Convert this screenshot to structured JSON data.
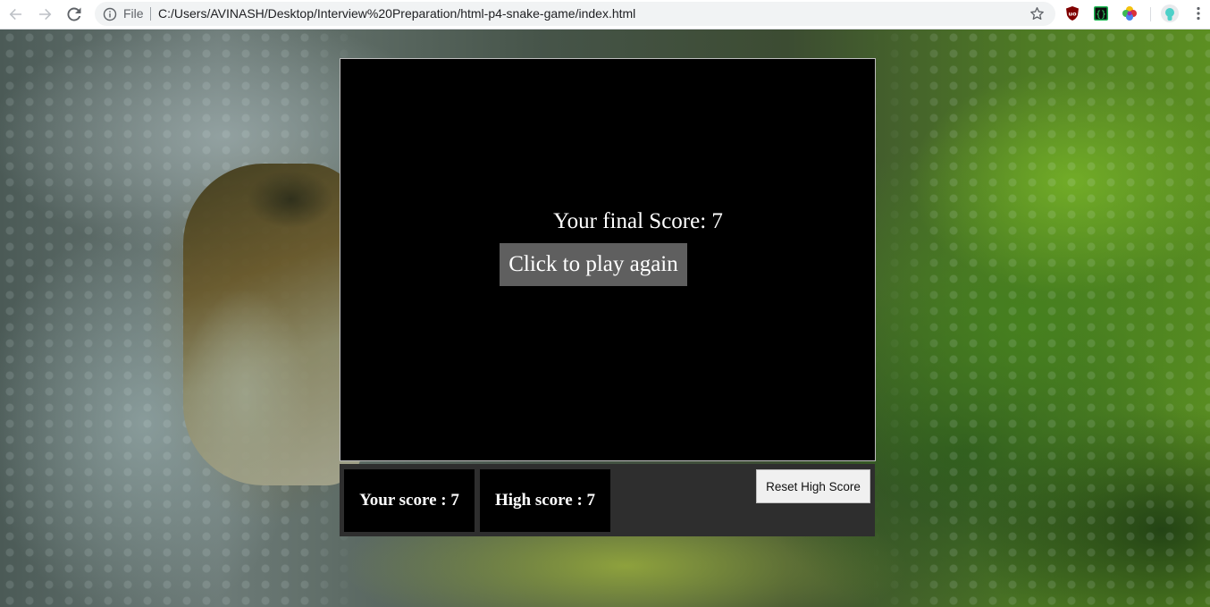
{
  "browser": {
    "scheme_label": "File",
    "url": "C:/Users/AVINASH/Desktop/Interview%20Preparation/html-p4-snake-game/index.html",
    "icons": [
      "back-arrow-icon",
      "forward-arrow-icon",
      "reload-icon",
      "info-icon",
      "bookmark-star-icon",
      "ublock-extension-icon",
      "json-extension-icon",
      "color-picker-extension-icon",
      "profile-avatar-icon",
      "menu-kebab-icon"
    ]
  },
  "game": {
    "final_score_text": "Your final Score: 7",
    "play_again_label": "Click to play again",
    "your_score_label": "Your score : 7",
    "high_score_label": "High score : 7",
    "reset_label": "Reset High Score"
  },
  "colors": {
    "board": "#000000",
    "button_gray": "#5f5f5f",
    "score_bar": "#2e2e2e"
  }
}
